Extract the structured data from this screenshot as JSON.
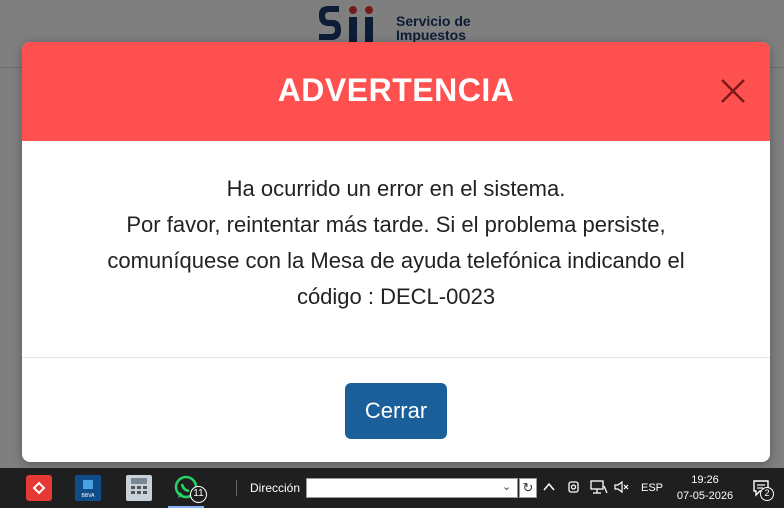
{
  "background": {
    "brand_line1": "Servicio de",
    "brand_line2": "Impuestos"
  },
  "modal": {
    "title": "ADVERTENCIA",
    "header_color": "#ff5050",
    "message_lines": [
      "Ha ocurrido un error en el sistema.",
      "Por favor, reintentar más tarde. Si el problema persiste,",
      "comuníquese con la Mesa de ayuda telefónica indicando el",
      "código : DECL-0023"
    ],
    "close_label": "Cerrar",
    "close_icon": "close-icon",
    "button_color": "#1a5f99"
  },
  "taskbar": {
    "apps": [
      {
        "name": "red-app-icon"
      },
      {
        "name": "bbva-icon",
        "label": "BBVA"
      },
      {
        "name": "calculator-icon"
      },
      {
        "name": "whatsapp-icon",
        "badge": "11"
      }
    ],
    "address_label": "Dirección",
    "address_value": "",
    "language": "ESP",
    "time": "19:26",
    "date": "07-05-2026",
    "notifications": "2"
  }
}
